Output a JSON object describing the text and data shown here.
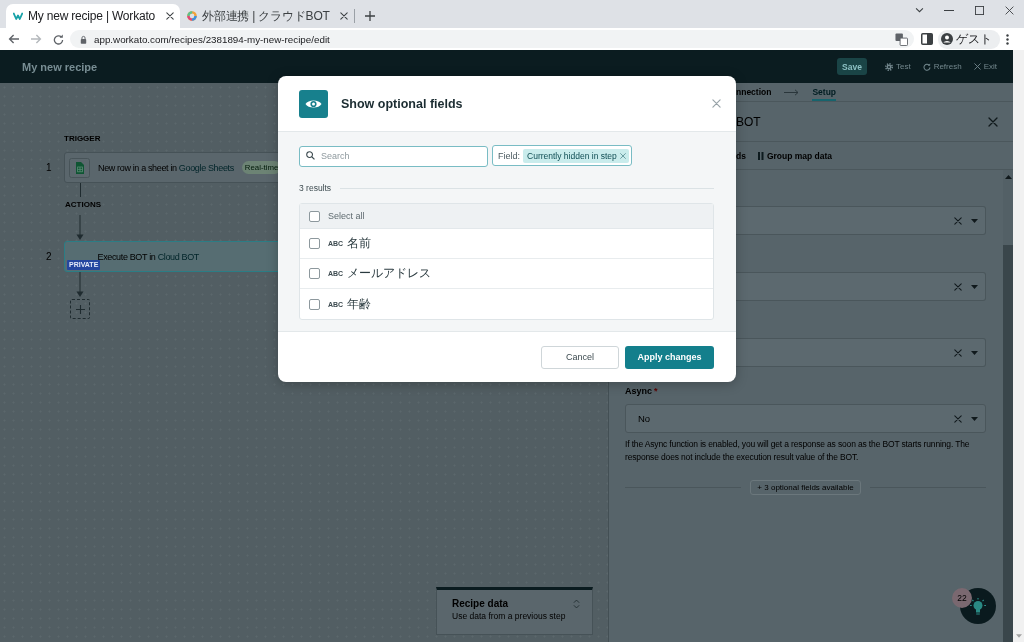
{
  "browser": {
    "tabs": [
      {
        "title": "My new recipe | Workato",
        "selected": true
      },
      {
        "title": "外部連携 | クラウドBOT",
        "selected": false
      }
    ],
    "url": "app.workato.com/recipes/2381894-my-new-recipe/edit",
    "profile": "ゲスト"
  },
  "app_header": {
    "title": "My new recipe",
    "actions": [
      {
        "label": "Save",
        "kind": "save"
      },
      {
        "label": "Test",
        "kind": "test"
      },
      {
        "label": "Refresh",
        "kind": "refresh"
      },
      {
        "label": "Exit",
        "kind": "exit"
      }
    ]
  },
  "canvas": {
    "sections": [
      {
        "label": "TRIGGER",
        "steps": [
          {
            "number": "1",
            "kind": "trigger",
            "action": "New row in a sheet in",
            "app": "Google Sheets",
            "badge": {
              "label": "Real-time",
              "kind": "realtime"
            },
            "selected": false
          }
        ]
      },
      {
        "label": "ACTIONS",
        "steps": [
          {
            "number": "2",
            "kind": "action",
            "action": "Execute BOT in",
            "app": "Cloud BOT",
            "badge": {
              "label": "PRIVATE",
              "kind": "private"
            },
            "selected": true
          }
        ]
      }
    ],
    "recipe_data": {
      "title": "Recipe data",
      "subtitle": "Use data from a previous step"
    }
  },
  "panel": {
    "steps_nav": [
      {
        "label": "nnection",
        "selected": false
      },
      {
        "label": "Setup",
        "selected": true
      }
    ],
    "title": "BOT",
    "toolbar": [
      {
        "label": "ds",
        "kind": "plain"
      },
      {
        "label": "Group map data",
        "kind": "group"
      }
    ],
    "fields": [
      {
        "kind": "select"
      },
      {
        "kind": "select"
      },
      {
        "kind": "select"
      },
      {
        "kind": "select",
        "label": "Async",
        "required_mark": "*",
        "value": "No",
        "hint": "If the Async function is enabled, you will get a response as soon as the BOT starts running. The response does not include the execution result value of the BOT."
      }
    ],
    "optional_fields": "+ 3 optional fields available",
    "help_badge": "22"
  },
  "modal": {
    "title": "Show optional fields",
    "search": {
      "placeholder": "Search"
    },
    "filter": {
      "label": "Field:",
      "value": "Currently hidden in step"
    },
    "result_count": "3 results",
    "select_all": {
      "label": "Select all",
      "checked": false
    },
    "fields": [
      {
        "type": "ABC",
        "name": "名前",
        "checked": false
      },
      {
        "type": "ABC",
        "name": "メールアドレス",
        "checked": false
      },
      {
        "type": "ABC",
        "name": "年齢",
        "checked": false
      }
    ],
    "buttons": [
      {
        "label": "Cancel",
        "kind": "secondary"
      },
      {
        "label": "Apply changes",
        "kind": "primary"
      }
    ]
  }
}
